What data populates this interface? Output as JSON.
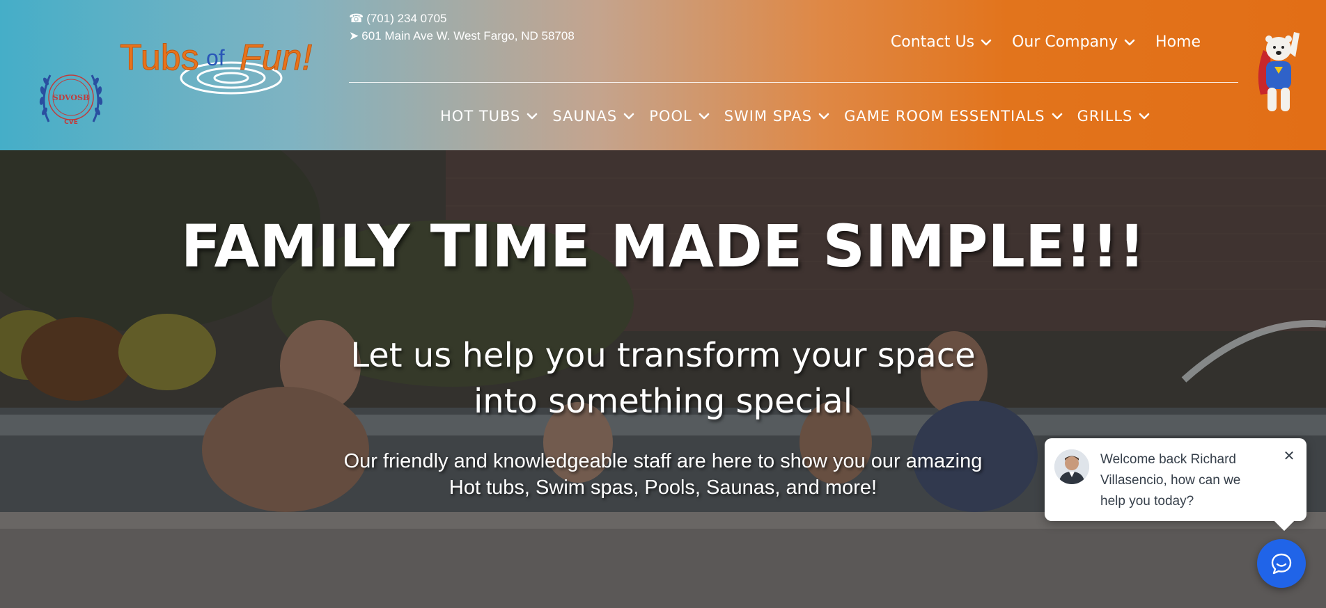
{
  "header": {
    "contact": {
      "phone_icon": "☎",
      "phone": "(701) 234 0705",
      "address_icon": "➤",
      "address": "601 Main Ave W. West Fargo, ND 58708"
    },
    "seal": {
      "line1": "SDVOSB",
      "line2": "CVE",
      "icon": "sdvosb-seal"
    },
    "logo": {
      "part1": "Tubs",
      "part2": "of",
      "part3": "Fun!"
    },
    "top_nav": [
      {
        "label": "Contact Us",
        "has_dropdown": true
      },
      {
        "label": "Our Company",
        "has_dropdown": true
      },
      {
        "label": "Home",
        "has_dropdown": false
      }
    ],
    "main_nav": [
      {
        "label": "HOT TUBS"
      },
      {
        "label": "SAUNAS"
      },
      {
        "label": "POOL"
      },
      {
        "label": "SWIM SPAS"
      },
      {
        "label": "GAME ROOM ESSENTIALS"
      },
      {
        "label": "GRILLS"
      }
    ],
    "mascot_icon": "polar-bear-superhero"
  },
  "hero": {
    "title": "FAMILY TIME MADE SIMPLE!!!",
    "subtitle_line1": "Let us help you transform your space",
    "subtitle_line2": "into something special",
    "desc_line1": "Our friendly and knowledgeable staff are here to show you our amazing",
    "desc_line2": "Hot tubs, Swim spas, Pools, Saunas, and more!"
  },
  "chat": {
    "message": "Welcome back Richard Villasencio, how can we help you today?",
    "close_icon": "✕",
    "launcher_icon": "chat-icon"
  },
  "colors": {
    "header_left": "#45aec8",
    "header_right": "#e26e16",
    "logo_orange": "#e8731c",
    "chat_blue": "#2064e8"
  }
}
